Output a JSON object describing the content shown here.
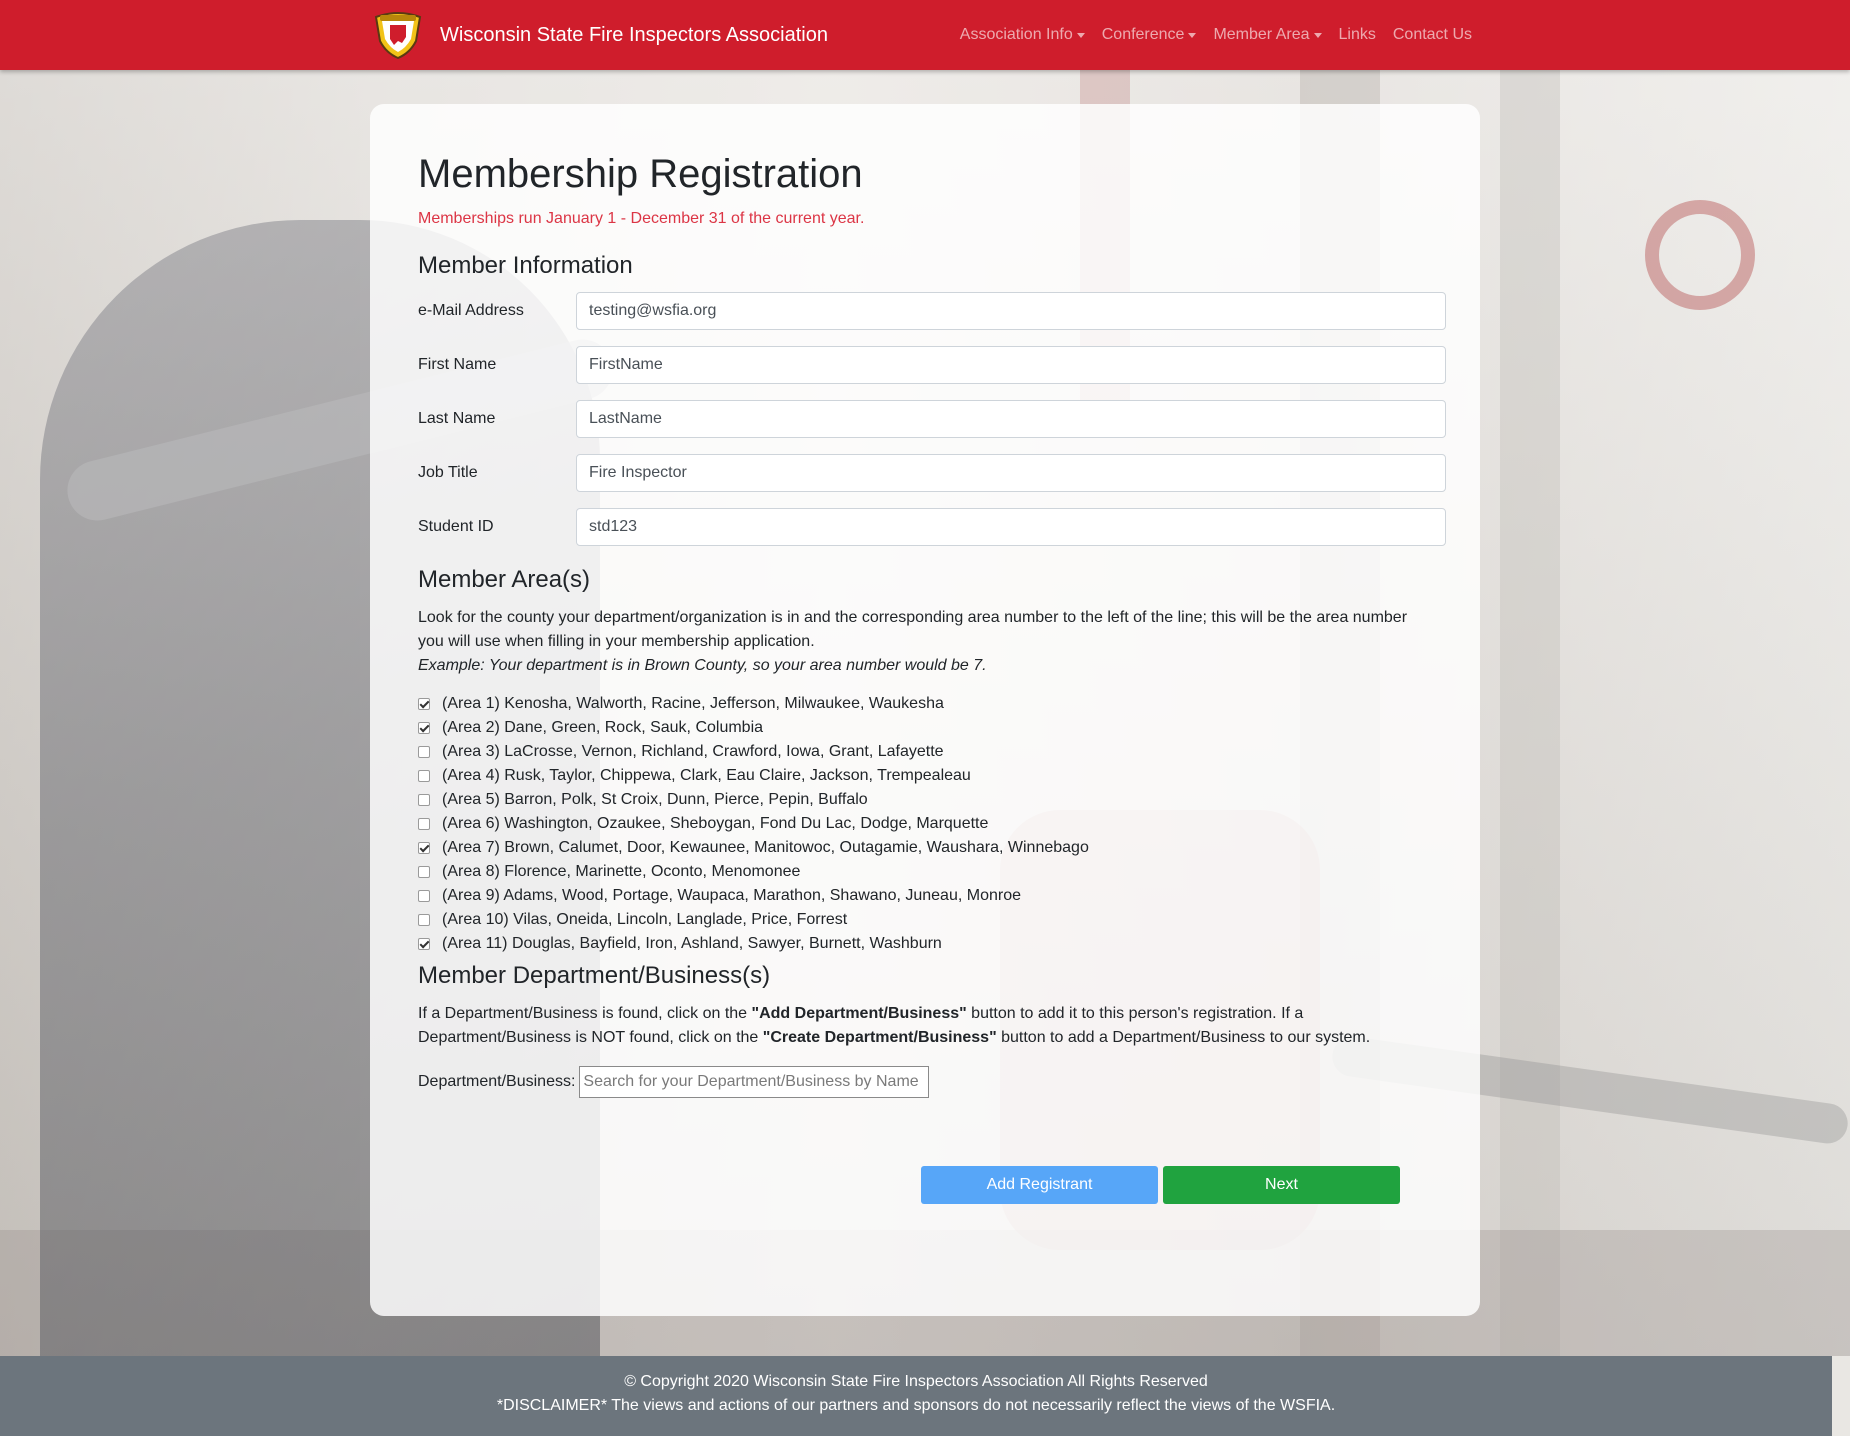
{
  "navbar": {
    "brand": "Wisconsin State Fire Inspectors Association",
    "logo_icon": "wsfia-shield-logo",
    "items": [
      {
        "label": "Association Info",
        "dropdown": true
      },
      {
        "label": "Conference",
        "dropdown": true
      },
      {
        "label": "Member Area",
        "dropdown": true
      },
      {
        "label": "Links",
        "dropdown": false
      },
      {
        "label": "Contact Us",
        "dropdown": false
      }
    ],
    "color": "#cf1d2c"
  },
  "page": {
    "title": "Membership Registration",
    "subtitle": "Memberships run January 1 - December 31 of the current year."
  },
  "member_info": {
    "heading": "Member Information",
    "fields": [
      {
        "label": "e-Mail Address",
        "value": "testing@wsfia.org"
      },
      {
        "label": "First Name",
        "value": "FirstName"
      },
      {
        "label": "Last Name",
        "value": "LastName"
      },
      {
        "label": "Job Title",
        "value": "Fire Inspector"
      },
      {
        "label": "Student ID",
        "value": "std123"
      }
    ]
  },
  "member_areas": {
    "heading": "Member Area(s)",
    "instructions_1": "Look for the county your department/organization is in and the corresponding area number to the left of the line; this will be the area number you will use when filling in your membership application.",
    "example": "Example: Your department is in Brown County, so your area number would be 7.",
    "areas": [
      {
        "label": "(Area 1) Kenosha, Walworth, Racine, Jefferson, Milwaukee, Waukesha",
        "checked": true
      },
      {
        "label": "(Area 2) Dane, Green, Rock, Sauk, Columbia",
        "checked": true
      },
      {
        "label": "(Area 3) LaCrosse, Vernon, Richland, Crawford, Iowa, Grant, Lafayette",
        "checked": false
      },
      {
        "label": "(Area 4) Rusk, Taylor, Chippewa, Clark, Eau Claire, Jackson, Trempealeau",
        "checked": false
      },
      {
        "label": "(Area 5) Barron, Polk, St Croix, Dunn, Pierce, Pepin, Buffalo",
        "checked": false
      },
      {
        "label": "(Area 6) Washington, Ozaukee, Sheboygan, Fond Du Lac, Dodge, Marquette",
        "checked": false
      },
      {
        "label": "(Area 7) Brown, Calumet, Door, Kewaunee, Manitowoc, Outagamie, Waushara, Winnebago",
        "checked": true
      },
      {
        "label": "(Area 8) Florence, Marinette, Oconto, Menomonee",
        "checked": false
      },
      {
        "label": "(Area 9) Adams, Wood, Portage, Waupaca, Marathon, Shawano, Juneau, Monroe",
        "checked": false
      },
      {
        "label": "(Area 10) Vilas, Oneida, Lincoln, Langlade, Price, Forrest",
        "checked": false
      },
      {
        "label": "(Area 11) Douglas, Bayfield, Iron, Ashland, Sawyer, Burnett, Washburn",
        "checked": true
      }
    ]
  },
  "departments": {
    "heading": "Member Department/Business(s)",
    "text_1": "If a Department/Business is found, click on the ",
    "add_btn_ref": "\"Add Department/Business\"",
    "text_2": " button to add it to this person's registration. If a Department/Business is NOT found, click on the ",
    "create_btn_ref": "\"Create Department/Business\"",
    "text_3": " button to add a Department/Business to our system.",
    "search_label": "Department/Business:",
    "search_placeholder": "Search for your Department/Business by Name"
  },
  "actions": {
    "add_registrant": "Add Registrant",
    "next": "Next",
    "add_color": "#57a6f8",
    "next_color": "#20a33f"
  },
  "footer": {
    "copyright": "© Copyright 2020 Wisconsin State Fire Inspectors Association All Rights Reserved",
    "disclaimer": "*DISCLAIMER* The views and actions of our partners and sponsors do not necessarily reflect the views of the WSFIA."
  }
}
